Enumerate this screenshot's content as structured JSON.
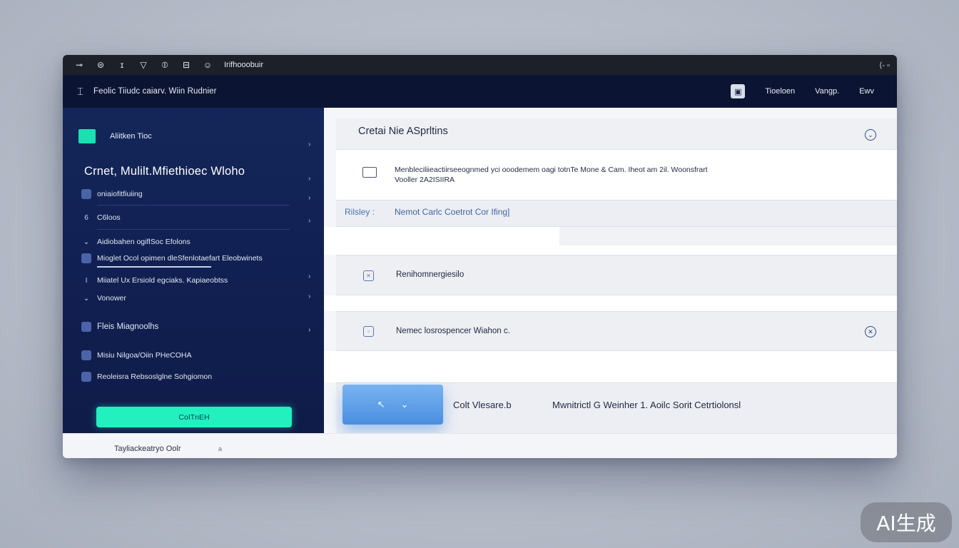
{
  "titlebar": {
    "icons": [
      "key-icon",
      "shield-icon",
      "cursor-icon",
      "funnel-icon",
      "compass-icon",
      "database-icon",
      "smile-icon"
    ],
    "title": "Irifhooobuir",
    "controls": "⟨- ▫"
  },
  "navbar": {
    "title": "Feolic Tiiudc caiarv.  Wiin  Rudnier",
    "items": [
      "Tioeloen",
      "Vangp.",
      "Ewv"
    ]
  },
  "sidebar": {
    "header_label": "Aliitken Tioc",
    "big_title": "Crnet, Mulilt.Mfiethioec Wloho",
    "items": [
      {
        "label": "oniaiofitfiuiing"
      },
      {
        "label": "C6loos"
      },
      {
        "label": "Aidiobahen ogiflSoc Efolons"
      },
      {
        "label": "Mioglet Ocol opimen dleSfenlotaefart Eleobwinets"
      },
      {
        "label": "Miiatel Ux Ersiold egciaks. Kapiaeobtss"
      },
      {
        "label": "Vonower"
      },
      {
        "label": "Fleis Miagnoolhs"
      },
      {
        "label": "Misiu Nilgoa/Oiin PHeCOHA"
      },
      {
        "label": "Reoleisra Rebsoslglne Sohgiomon"
      }
    ],
    "cta_label": "CoITnEH"
  },
  "main": {
    "header_title": "Cretai Nie ASprltins",
    "description_line1": "Menbleciliieactiirseeognmed yci ooodemem oagi totnTe Mone & Cam. Iheot am 2il. Woonsfrart",
    "description_line2": "Vooller 2A2ISIIRA",
    "meta_label": "Rilsley :",
    "meta_value": "Nemot Carlc Coetrot  Cor Ifing]",
    "rows": [
      {
        "label": "Renihomnergiesilo"
      },
      {
        "label": "Nemec losrospencer Wiahon c."
      }
    ],
    "bottom_label_1": "Colt  Vlesare.b",
    "bottom_label_2": "Mwnitrictl G  Weinher  1.  Aoilc  Sorit Cetrtiolonsl"
  },
  "status": {
    "text": "Tayliackeatryo  Oolr",
    "mark": "a"
  },
  "watermark": "AI生成"
}
